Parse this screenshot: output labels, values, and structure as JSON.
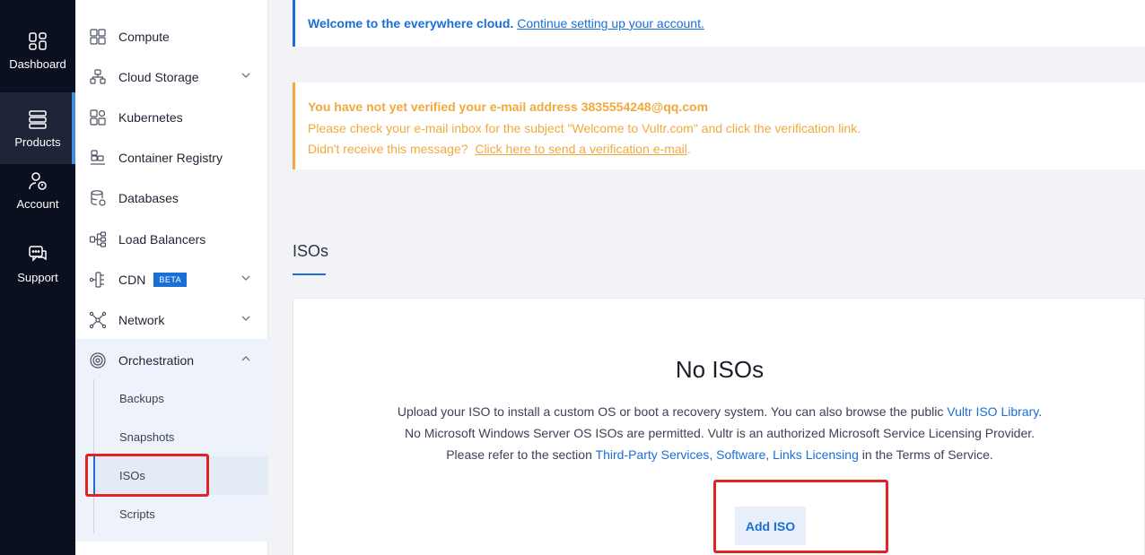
{
  "rail": {
    "dashboard": "Dashboard",
    "products": "Products",
    "account": "Account",
    "support": "Support"
  },
  "sidebar": {
    "items": [
      {
        "label": "Compute",
        "icon": "compute-icon"
      },
      {
        "label": "Cloud Storage",
        "icon": "storage-icon",
        "expandable": true
      },
      {
        "label": "Kubernetes",
        "icon": "kubernetes-icon"
      },
      {
        "label": "Container Registry",
        "icon": "registry-icon"
      },
      {
        "label": "Databases",
        "icon": "database-icon"
      },
      {
        "label": "Load Balancers",
        "icon": "load-balancer-icon"
      },
      {
        "label": "CDN",
        "icon": "cdn-icon",
        "badge": "BETA",
        "expandable": true
      },
      {
        "label": "Network",
        "icon": "network-icon",
        "expandable": true
      },
      {
        "label": "Orchestration",
        "icon": "orchestration-icon",
        "expanded": true
      }
    ],
    "orchestration_children": [
      "Backups",
      "Snapshots",
      "ISOs",
      "Scripts"
    ],
    "active_child": "ISOs"
  },
  "welcome": {
    "bold": "Welcome to the everywhere cloud.",
    "link": "Continue setting up your account."
  },
  "verify": {
    "line1": "You have not yet verified your e-mail address 3835554248@qq.com",
    "line2": "Please check your e-mail inbox for the subject \"Welcome to Vultr.com\" and click the verification link.",
    "line3_prefix": "Didn't receive this message?",
    "line3_link": "Click here to send a verification e-mail",
    "line3_suffix": "."
  },
  "page": {
    "title": "ISOs"
  },
  "empty_state": {
    "title": "No ISOs",
    "line1_text": "Upload your ISO to install a custom OS or boot a recovery system. You can also browse the public ",
    "line1_link": "Vultr ISO Library",
    "line1_end": ".",
    "line2": "No Microsoft Windows Server OS ISOs are permitted. Vultr is an authorized Microsoft Service Licensing Provider.",
    "line3_text": "Please refer to the section ",
    "line3_link": "Third-Party Services, Software, Links Licensing",
    "line3_end": " in the Terms of Service.",
    "button": "Add ISO"
  },
  "colors": {
    "accent": "#1a6fd6",
    "warning": "#f2a93b",
    "rail_bg": "#0b1021",
    "highlight": "#e02424"
  }
}
